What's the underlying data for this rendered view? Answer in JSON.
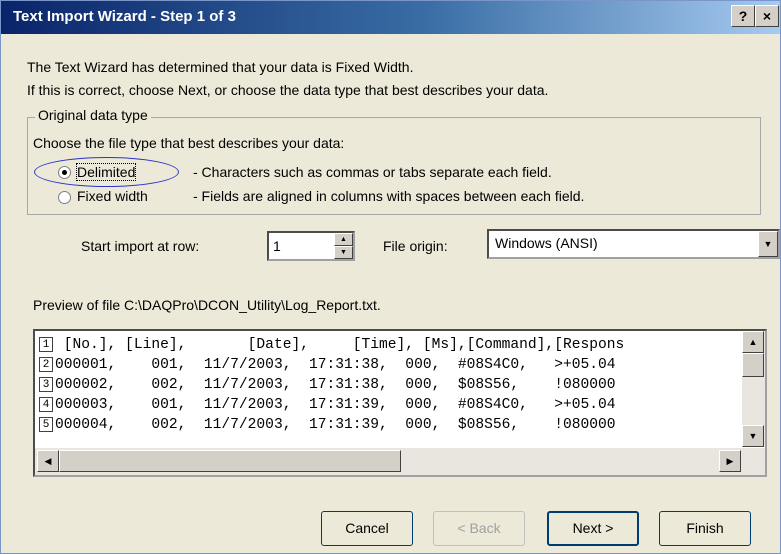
{
  "window": {
    "title": "Text Import Wizard - Step 1 of 3",
    "help_label": "?",
    "close_label": "×"
  },
  "intro": {
    "line1": "The Text Wizard has determined that your data is Fixed Width.",
    "line2": "If this is correct, choose Next, or choose the data type that best describes your data."
  },
  "original_data_type": {
    "legend": "Original data type",
    "prompt": "Choose the file type that best describes your data:",
    "options": [
      {
        "label": "Delimited",
        "description": "- Characters such as commas or tabs separate each field.",
        "selected": true
      },
      {
        "label": "Fixed width",
        "description": "- Fields are aligned in columns with spaces between each field.",
        "selected": false
      }
    ]
  },
  "start_row": {
    "label": "Start import at row:",
    "value": "1"
  },
  "file_origin": {
    "label": "File origin:",
    "value": "Windows (ANSI)"
  },
  "preview": {
    "label": "Preview of file C:\\DAQPro\\DCON_Utility\\Log_Report.txt.",
    "lines": [
      {
        "num": "1",
        "text": " [No.], [Line],       [Date],     [Time], [Ms],[Command],[Respons"
      },
      {
        "num": "2",
        "text": "000001,    001,  11/7/2003,  17:31:38,  000,  #08S4C0,   >+05.04"
      },
      {
        "num": "3",
        "text": "000002,    002,  11/7/2003,  17:31:38,  000,  $08S56,    !080000"
      },
      {
        "num": "4",
        "text": "000003,    001,  11/7/2003,  17:31:39,  000,  #08S4C0,   >+05.04"
      },
      {
        "num": "5",
        "text": "000004,    002,  11/7/2003,  17:31:39,  000,  $08S56,    !080000"
      }
    ]
  },
  "buttons": {
    "cancel": "Cancel",
    "back": "< Back",
    "next": "Next >",
    "finish": "Finish"
  },
  "annotation": {
    "color": "#2b35c8"
  }
}
